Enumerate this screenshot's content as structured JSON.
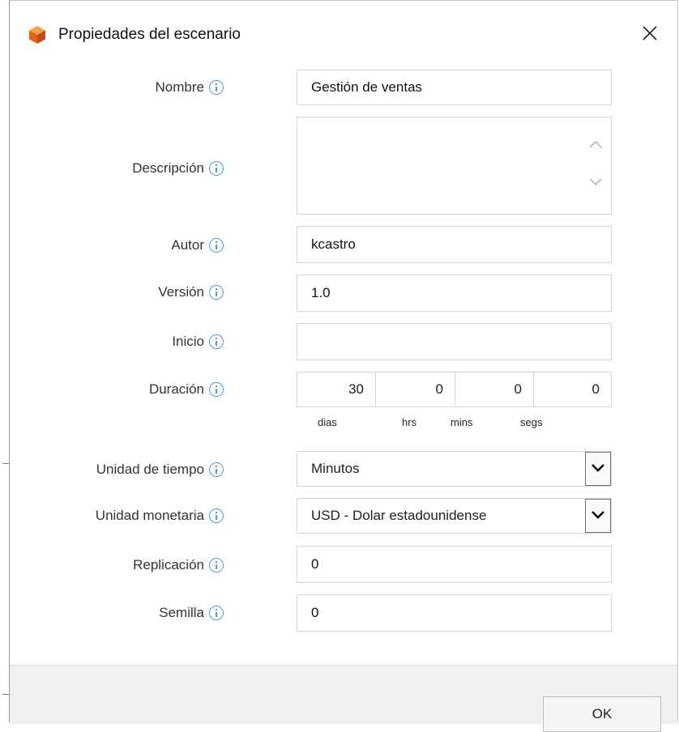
{
  "window": {
    "title": "Propiedades del escenario",
    "close_glyph": "✕",
    "icon": "cube-icon"
  },
  "fields": {
    "nombre": {
      "label": "Nombre",
      "value": "Gestión de ventas"
    },
    "descripcion": {
      "label": "Descripción",
      "value": ""
    },
    "autor": {
      "label": "Autor",
      "value": "kcastro"
    },
    "version": {
      "label": "Versión",
      "value": "1.0"
    },
    "inicio": {
      "label": "Inicio",
      "value": ""
    },
    "duracion": {
      "label": "Duración",
      "dias": "30",
      "hrs": "0",
      "mins": "0",
      "segs": "0",
      "units": {
        "dias": "dias",
        "hrs": "hrs",
        "mins": "mins",
        "segs": "segs"
      }
    },
    "unidad_tiempo": {
      "label": "Unidad de tiempo",
      "value": "Minutos"
    },
    "unidad_monetaria": {
      "label": "Unidad monetaria",
      "value": "USD - Dolar estadounidense"
    },
    "replicacion": {
      "label": "Replicación",
      "value": "0"
    },
    "semilla": {
      "label": "Semilla",
      "value": "0"
    }
  },
  "footer": {
    "ok_label": "OK"
  },
  "colors": {
    "info_accent": "#4a9ad8",
    "footer_bg": "#f0f0f0"
  }
}
